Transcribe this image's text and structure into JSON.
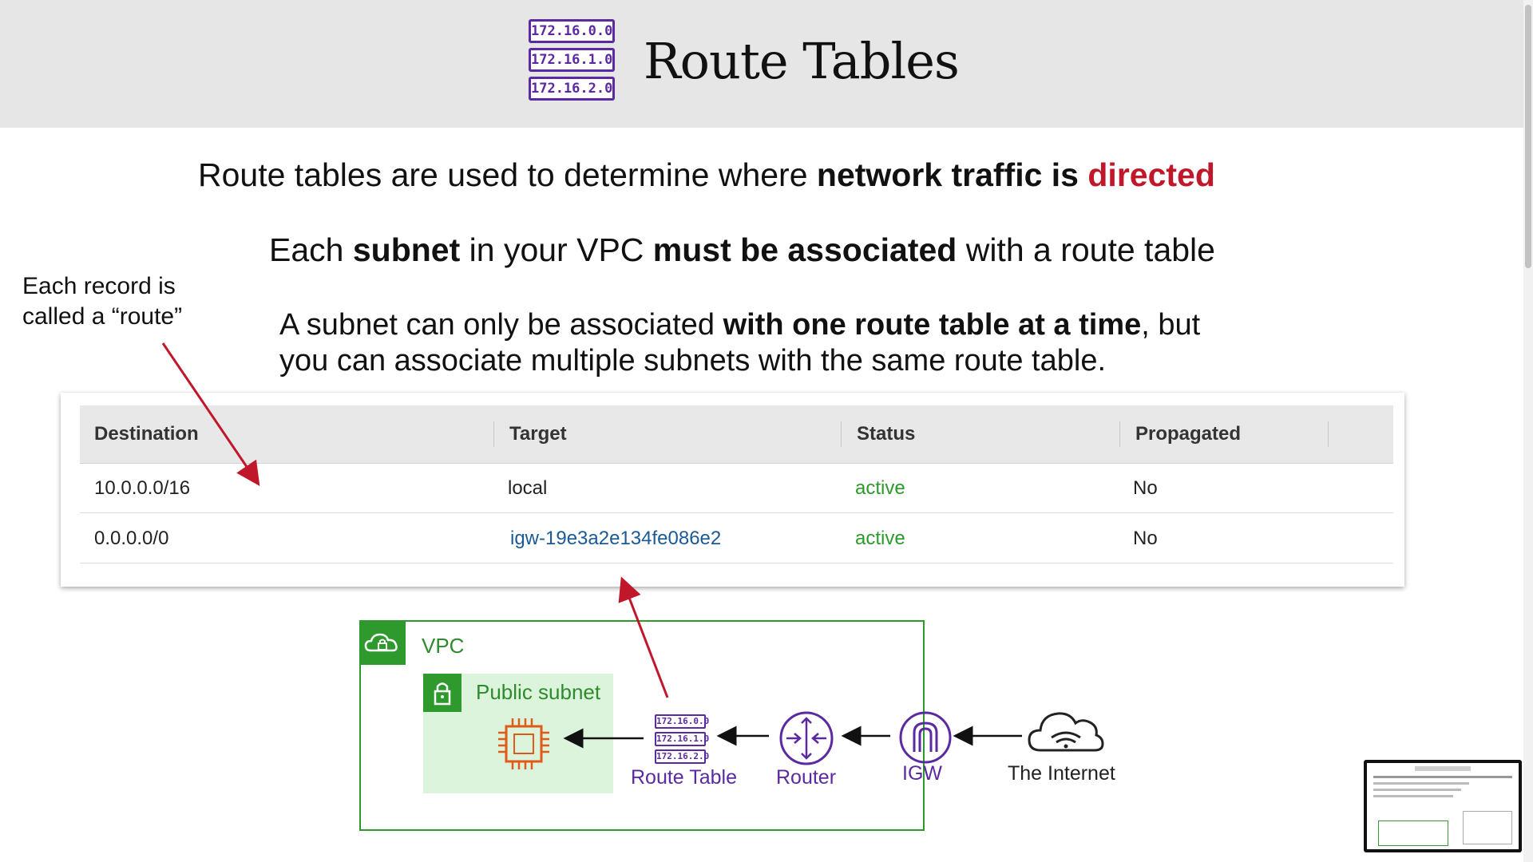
{
  "header": {
    "icon_chips": [
      "172.16.0.0",
      "172.16.1.0",
      "172.16.2.0"
    ],
    "title": "Route Tables"
  },
  "lines": {
    "l1_a": "Route tables are used to determine where ",
    "l1_b": "network traffic is ",
    "l1_c": "directed",
    "l2_a": "Each ",
    "l2_b": "subnet",
    "l2_c": " in your VPC ",
    "l2_d": "must be associated",
    "l2_e": " with a route table",
    "l3_a": "A subnet can only be associated ",
    "l3_b": "with one route table at a time",
    "l3_c": ", but",
    "l4": "you can associate multiple subnets with the same route table."
  },
  "note": {
    "line1": "Each record is",
    "line2": "called a “route”"
  },
  "route_table": {
    "headers": [
      "Destination",
      "Target",
      "Status",
      "Propagated"
    ],
    "rows": [
      {
        "destination": "10.0.0.0/16",
        "target": "local",
        "status": "active",
        "propagated": "No"
      },
      {
        "destination": "0.0.0.0/0",
        "target": "igw-19e3a2e134fe086e2",
        "status": "active",
        "propagated": "No"
      }
    ]
  },
  "diagram": {
    "vpc_label": "VPC",
    "subnet_label": "Public subnet",
    "route_table_chips": [
      "172.16.0.0",
      "172.16.1.0",
      "172.16.2.0"
    ],
    "route_table_label": "Route Table",
    "router_label": "Router",
    "igw_label": "IGW",
    "internet_label": "The Internet"
  },
  "colors": {
    "accent_red": "#c0172b",
    "purple": "#5b2aa0",
    "green": "#2e9a2e",
    "link_blue": "#1a5a96"
  }
}
